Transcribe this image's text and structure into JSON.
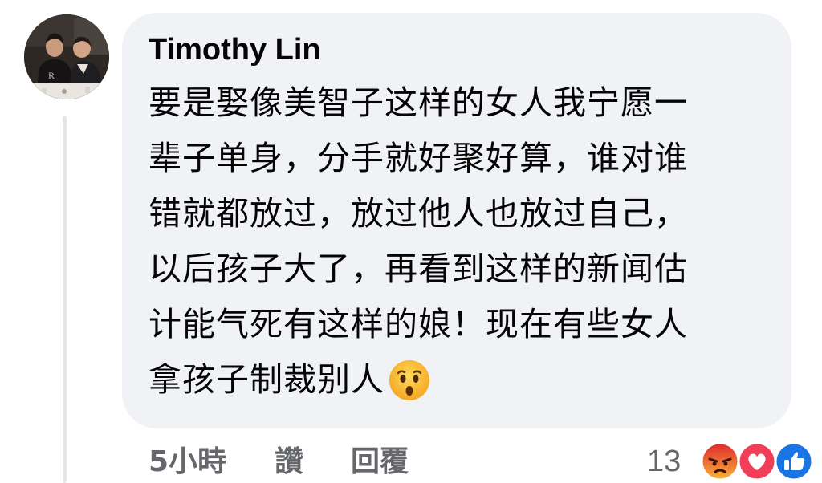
{
  "comment": {
    "author": "Timothy Lin",
    "text_lines": [
      "要是娶像美智子这样的女人我宁愿一",
      "辈子单身，分手就好聚好算，谁对谁",
      "错就都放过，放过他人也放过自己，",
      "以后孩子大了，再看到这样的新闻估",
      "计能气死有这样的娘！现在有些女人",
      "拿孩子制裁别人"
    ],
    "trailing_emoji": "hushed-face-emoji"
  },
  "actions": {
    "timestamp": "5小時",
    "like_label": "讚",
    "reply_label": "回覆"
  },
  "reactions": {
    "count": "13",
    "icons": [
      "angry-reaction-icon",
      "love-reaction-icon",
      "like-reaction-icon"
    ],
    "colors": {
      "angry": "#f0684a",
      "love": "#f33e58",
      "like": "#1b74e4"
    }
  },
  "colors": {
    "bubble": "#f0f2f5",
    "text": "#050505",
    "muted": "#65676b",
    "thread_line": "#e3e5e8"
  }
}
